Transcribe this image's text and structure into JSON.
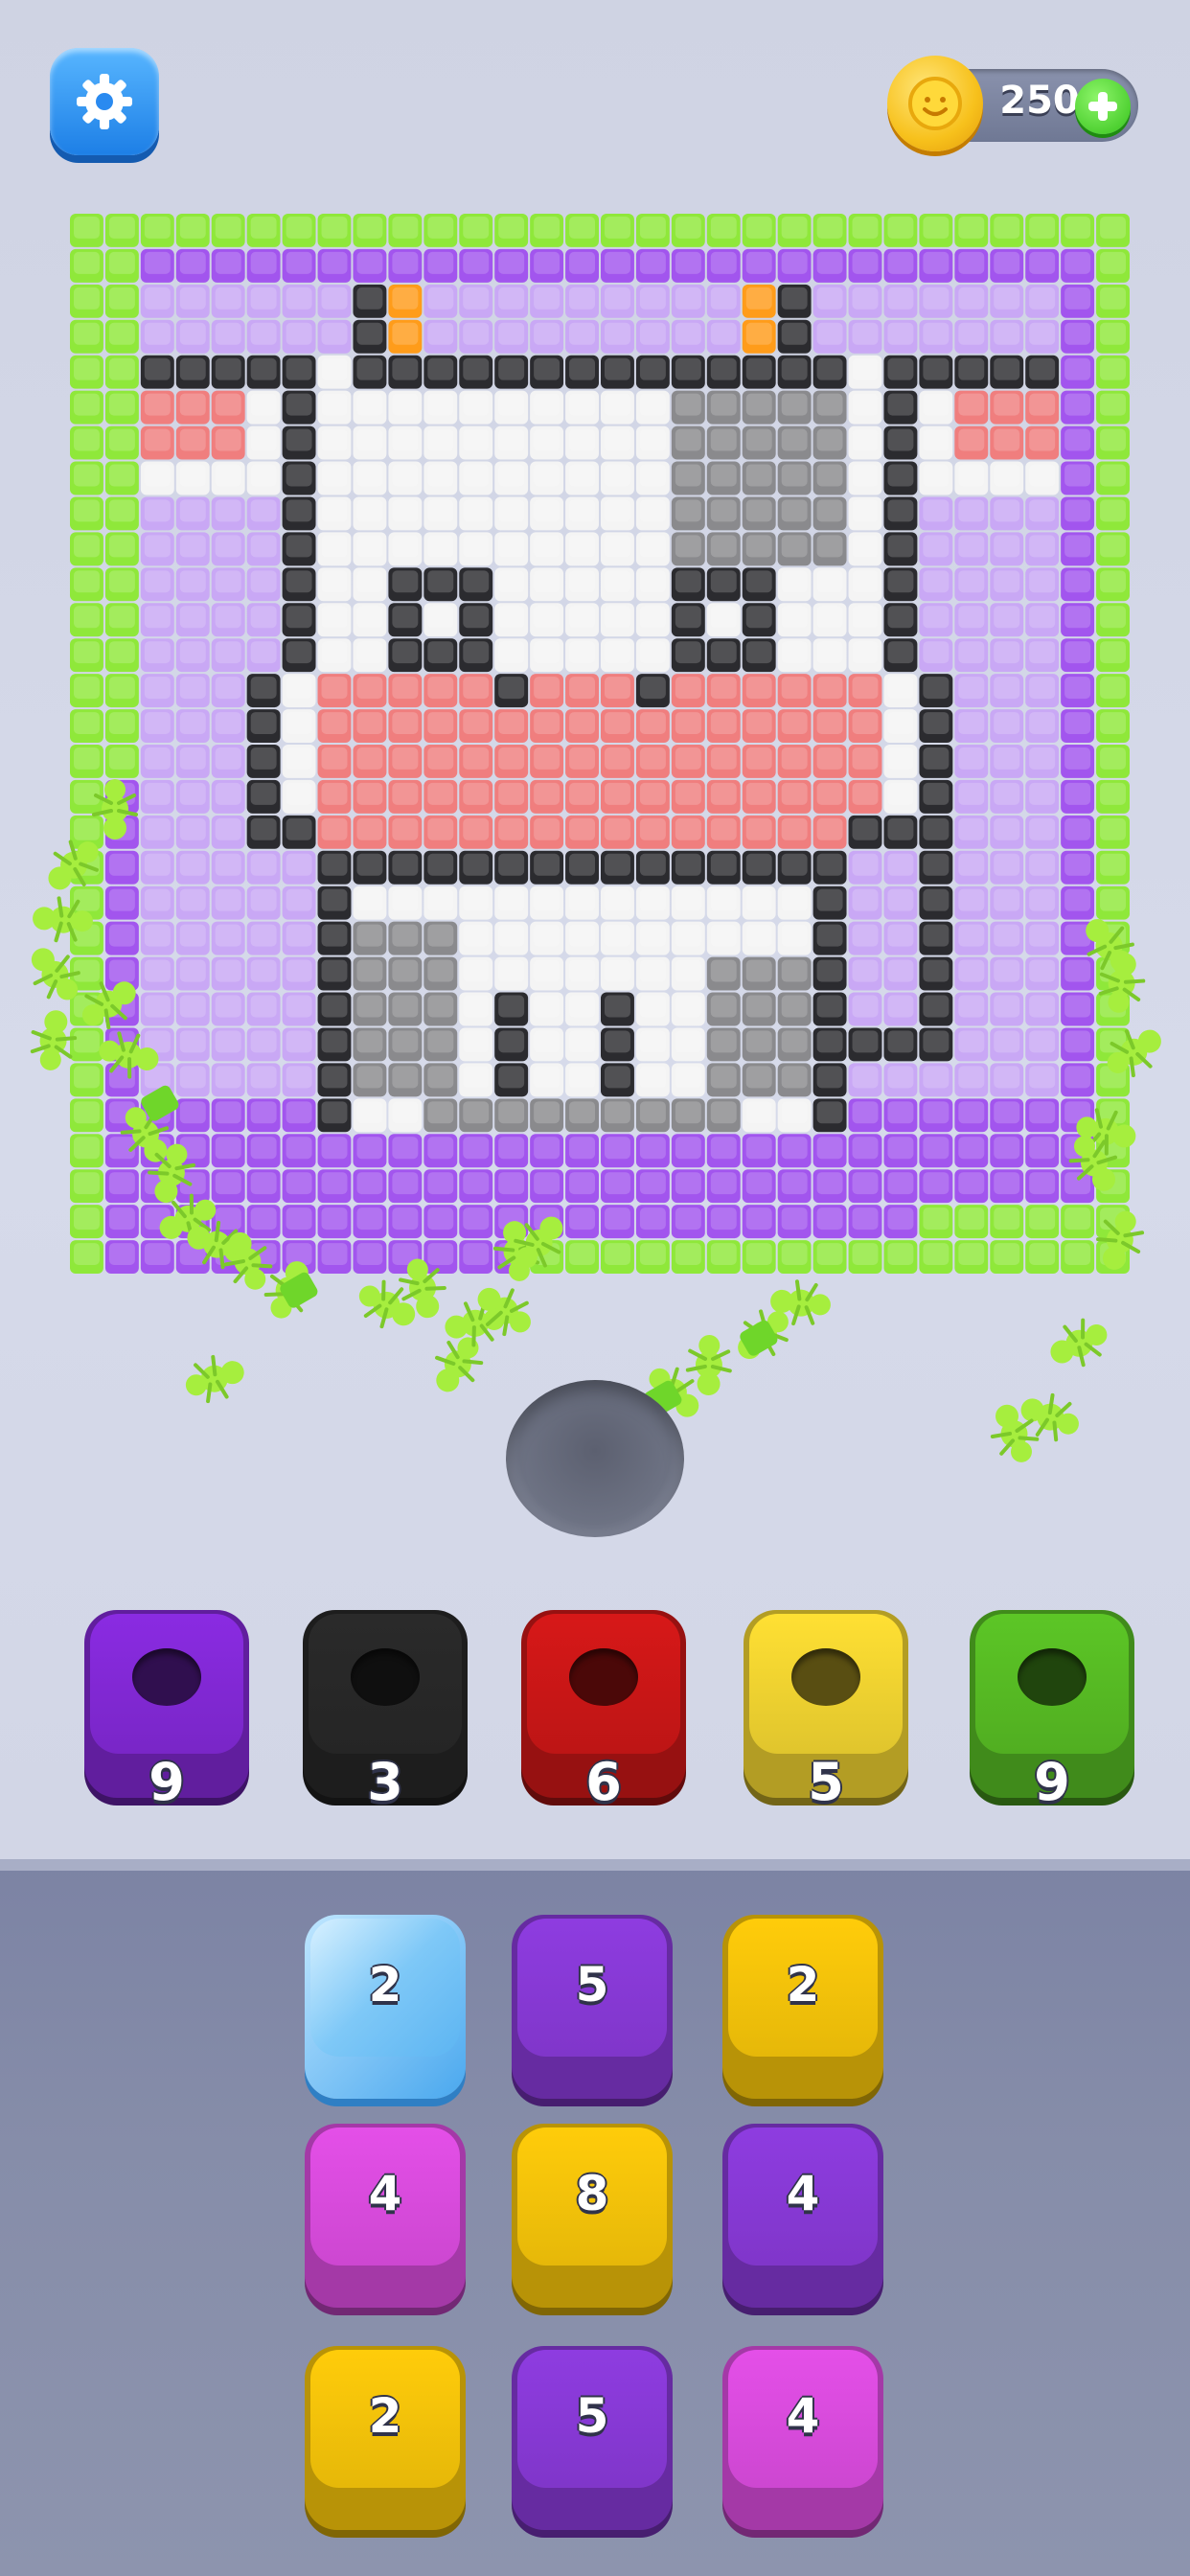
{
  "header": {
    "settings_icon": "gear-icon",
    "coin_icon": "smiley-coin-icon",
    "coins": "250",
    "add_icon": "plus-icon"
  },
  "board": {
    "image": "cow-face",
    "grid_size": 30
  },
  "collector_bins": [
    {
      "color": "#8a2be2",
      "count": "9"
    },
    {
      "color": "#2a2a2a",
      "count": "3"
    },
    {
      "color": "#d71818",
      "count": "6"
    },
    {
      "color": "#ffe033",
      "count": "5"
    },
    {
      "color": "#5cc626",
      "count": "9"
    }
  ],
  "tiles": [
    {
      "color": "ice",
      "count": "2"
    },
    {
      "color": "#8e3ce0",
      "count": "5"
    },
    {
      "color": "#ffcc0a",
      "count": "2"
    },
    {
      "color": "#e44fe8",
      "count": "4"
    },
    {
      "color": "#ffcc0a",
      "count": "8"
    },
    {
      "color": "#8e3ce0",
      "count": "4"
    },
    {
      "color": "#ffcc0a",
      "count": "2"
    },
    {
      "color": "#8e3ce0",
      "count": "5"
    },
    {
      "color": "#e44fe8",
      "count": "4"
    }
  ],
  "colors": {
    "green": "#8fe83a",
    "purple": "#a255ee",
    "lavender": "#c9a8f5",
    "black": "#2b2b2f",
    "white": "#f4f4f4",
    "gray": "#8a8a8d",
    "pink": "#f07e7e",
    "orange": "#ff9c1a",
    "ant": "#a6ee3e"
  }
}
